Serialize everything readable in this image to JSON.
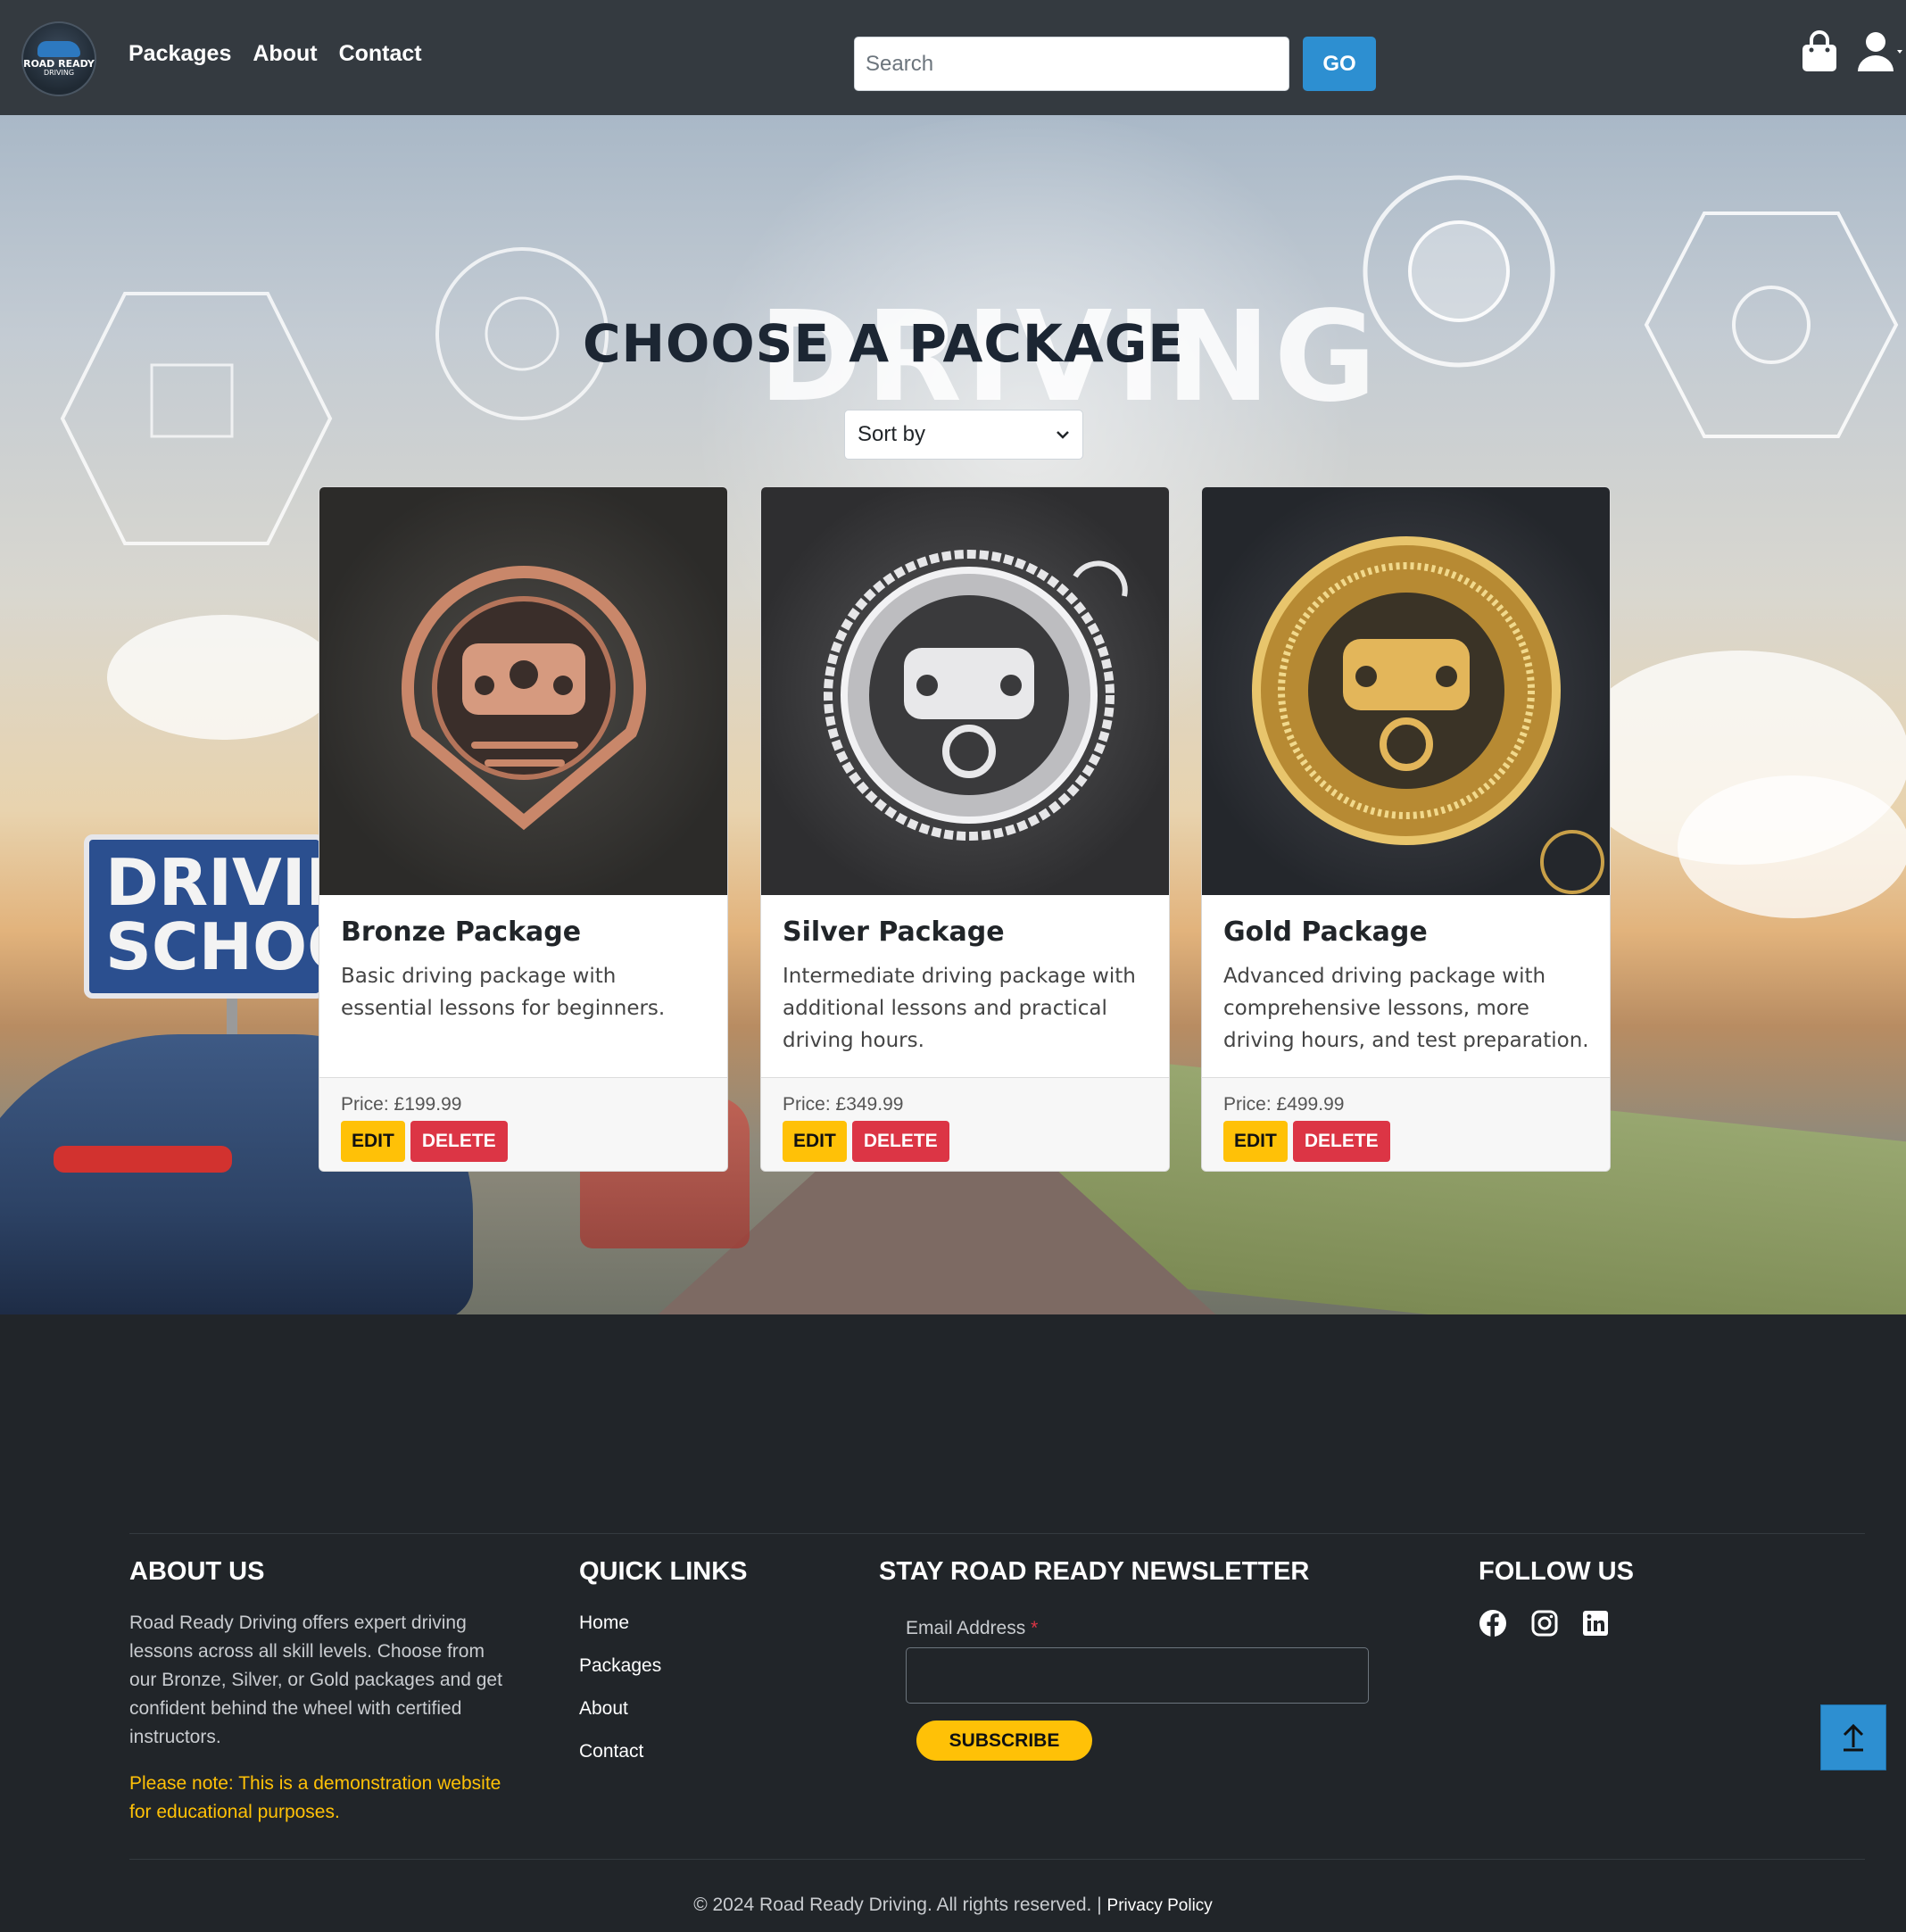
{
  "navbar": {
    "logo_text_line1": "ROAD READY",
    "logo_text_line2": "DRIVING",
    "links": [
      "Packages",
      "About",
      "Contact"
    ],
    "search_placeholder": "Search",
    "search_button": "GO"
  },
  "hero": {
    "title": "CHOOSE A PACKAGE",
    "sort_label": "Sort by",
    "bg_word": "DRIVING",
    "sign_text": "DRIVIN\nSCHOO"
  },
  "packages": [
    {
      "name": "Bronze Package",
      "description": "Basic driving package with essential lessons for beginners.",
      "price": "Price: £199.99",
      "edit": "EDIT",
      "delete": "DELETE",
      "badge_color": "#c9876a"
    },
    {
      "name": "Silver Package",
      "description": "Intermediate driving package with additional lessons and practical driving hours.",
      "price": "Price: £349.99",
      "edit": "EDIT",
      "delete": "DELETE",
      "badge_color": "#d4d4d6"
    },
    {
      "name": "Gold Package",
      "description": "Advanced driving package with comprehensive lessons, more driving hours, and test preparation.",
      "price": "Price: £499.99",
      "edit": "EDIT",
      "delete": "DELETE",
      "badge_color": "#d9a94a"
    }
  ],
  "footer": {
    "about_heading": "ABOUT US",
    "about_text": "Road Ready Driving offers expert driving lessons across all skill levels. Choose from our Bronze, Silver, or Gold packages and get confident behind the wheel with certified instructors.",
    "note_text": "Please note: This is a demonstration website for educational purposes.",
    "quick_links_heading": "QUICK LINKS",
    "quick_links": [
      "Home",
      "Packages",
      "About",
      "Contact"
    ],
    "newsletter_heading": "STAY ROAD READY NEWSLETTER",
    "email_label": "Email Address",
    "email_required_mark": "*",
    "email_value": "",
    "subscribe_button": "SUBSCRIBE",
    "follow_heading": "FOLLOW US",
    "social_icons": [
      "facebook-icon",
      "instagram-icon",
      "linkedin-icon"
    ],
    "copyright": "© 2024 Road Ready Driving. All rights reserved.",
    "separator": "|",
    "privacy_link": "Privacy Policy"
  },
  "colors": {
    "navbar_bg": "#343a40",
    "primary_blue": "#2d8fd1",
    "warning_yellow": "#ffc107",
    "danger_red": "#dc3545",
    "footer_bg": "#212529"
  }
}
